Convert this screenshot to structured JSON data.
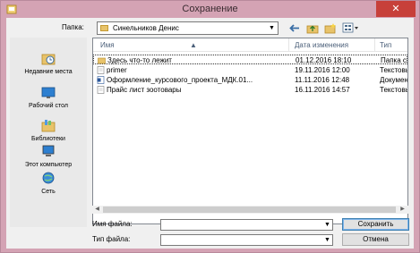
{
  "window": {
    "title": "Сохранение",
    "close_glyph": "✕"
  },
  "lookin": {
    "label": "Папка:",
    "value": "Синельников Денис"
  },
  "toolbar": {
    "icons": [
      "back-arrow-icon",
      "up-folder-icon",
      "new-folder-icon",
      "view-menu-icon"
    ]
  },
  "places": [
    {
      "label": "Недавние места",
      "icon": "recent-places-icon"
    },
    {
      "label": "Рабочий стол",
      "icon": "desktop-icon"
    },
    {
      "label": "Библиотеки",
      "icon": "libraries-icon"
    },
    {
      "label": "Этот компьютер",
      "icon": "computer-icon"
    },
    {
      "label": "Сеть",
      "icon": "network-icon"
    }
  ],
  "columns": {
    "name": "Имя",
    "date": "Дата изменения",
    "type": "Тип"
  },
  "files": [
    {
      "name": "Здесь что-то лежит",
      "date": "01.12.2016 18:10",
      "type": "Папка с ф",
      "icon": "folder-icon"
    },
    {
      "name": "primer",
      "date": "19.11.2016 12:00",
      "type": "Текстовы",
      "icon": "text-file-icon"
    },
    {
      "name": "Оформление_курсового_проекта_МДК.01...",
      "date": "11.11.2016 12:48",
      "type": "Документ",
      "icon": "word-document-icon"
    },
    {
      "name": "Прайс лист зоотовары",
      "date": "16.11.2016 14:57",
      "type": "Текстовы",
      "icon": "text-file-icon"
    }
  ],
  "filename": {
    "label": "Имя файла:",
    "value": ""
  },
  "filetype": {
    "label": "Тип файла:",
    "value": ""
  },
  "buttons": {
    "save": "Сохранить",
    "cancel": "Отмена"
  },
  "colors": {
    "titlebar": "#d4a3b4",
    "close": "#c7403a",
    "folder": "#e8c36a"
  }
}
